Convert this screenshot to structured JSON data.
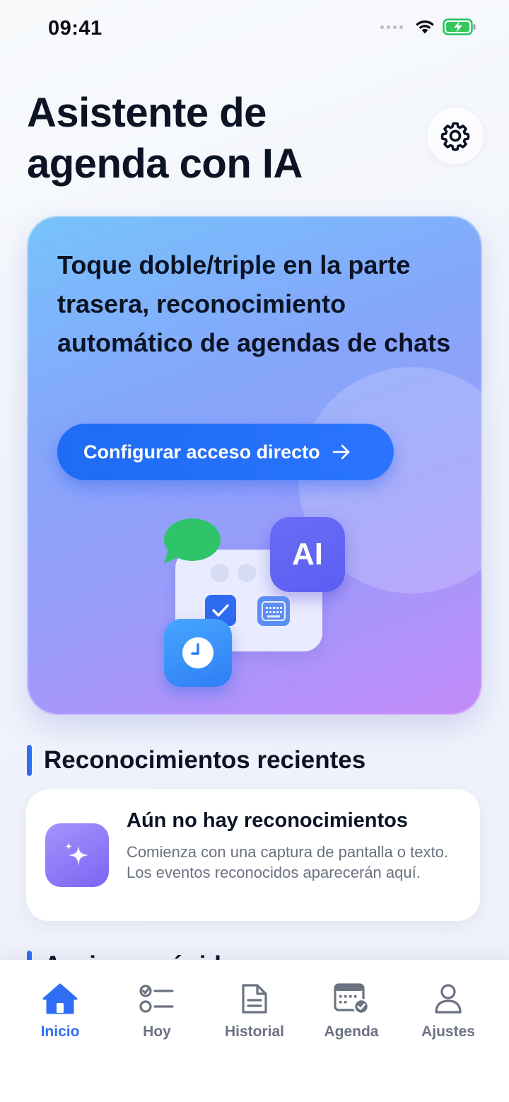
{
  "status_bar": {
    "time": "09:41"
  },
  "header": {
    "title": "Asistente de agenda con IA"
  },
  "hero": {
    "heading": "Toque doble/triple en la parte trasera, reconocimiento automático de agendas de chats",
    "button_label": "Configurar acceso directo",
    "ai_badge": "AI"
  },
  "recent": {
    "section_title": "Reconocimientos recientes",
    "empty_title": "Aún no hay reconocimientos",
    "empty_description": "Comienza con una captura de pantalla o texto. Los eventos reconocidos aparecerán aquí."
  },
  "next_section": {
    "title": "Acciones rápidas"
  },
  "tab_bar": {
    "items": [
      {
        "label": "Inicio",
        "icon": "home-icon",
        "active": true
      },
      {
        "label": "Hoy",
        "icon": "checklist-icon",
        "active": false
      },
      {
        "label": "Historial",
        "icon": "document-icon",
        "active": false
      },
      {
        "label": "Agenda",
        "icon": "calendar-icon",
        "active": false
      },
      {
        "label": "Ajustes",
        "icon": "person-icon",
        "active": false
      }
    ]
  },
  "colors": {
    "accent": "#2f6df5",
    "title": "#0b1324",
    "muted": "#6b7280"
  }
}
